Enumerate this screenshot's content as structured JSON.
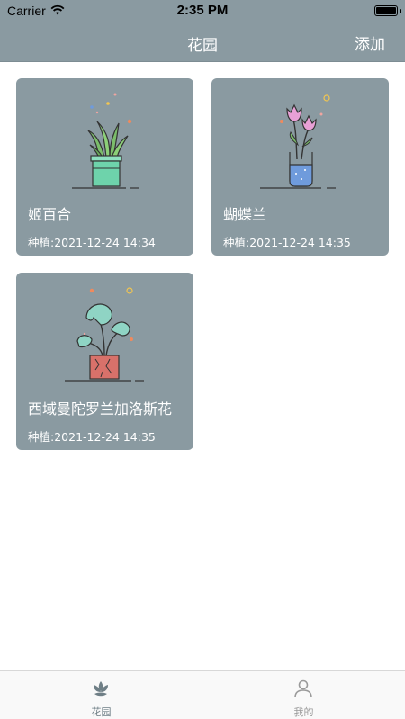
{
  "status_bar": {
    "carrier": "Carrier",
    "time": "2:35 PM"
  },
  "nav": {
    "title": "花园",
    "add_label": "添加"
  },
  "plants": [
    {
      "name": "姬百合",
      "planted": "种植:2021-12-24 14:34",
      "icon": "potted-aloe-icon"
    },
    {
      "name": "蝴蝶兰",
      "planted": "种植:2021-12-24 14:35",
      "icon": "tulip-vase-icon"
    },
    {
      "name": "西域曼陀罗兰加洛斯花",
      "planted": "种植:2021-12-24 14:35",
      "icon": "monstera-pot-icon"
    }
  ],
  "tabs": [
    {
      "label": "花园",
      "icon": "flower-icon",
      "active": true
    },
    {
      "label": "我的",
      "icon": "person-icon",
      "active": false
    }
  ],
  "colors": {
    "theme": "#8a9aa1",
    "card_text": "#ffffff",
    "tab_active": "#6f7f86"
  }
}
